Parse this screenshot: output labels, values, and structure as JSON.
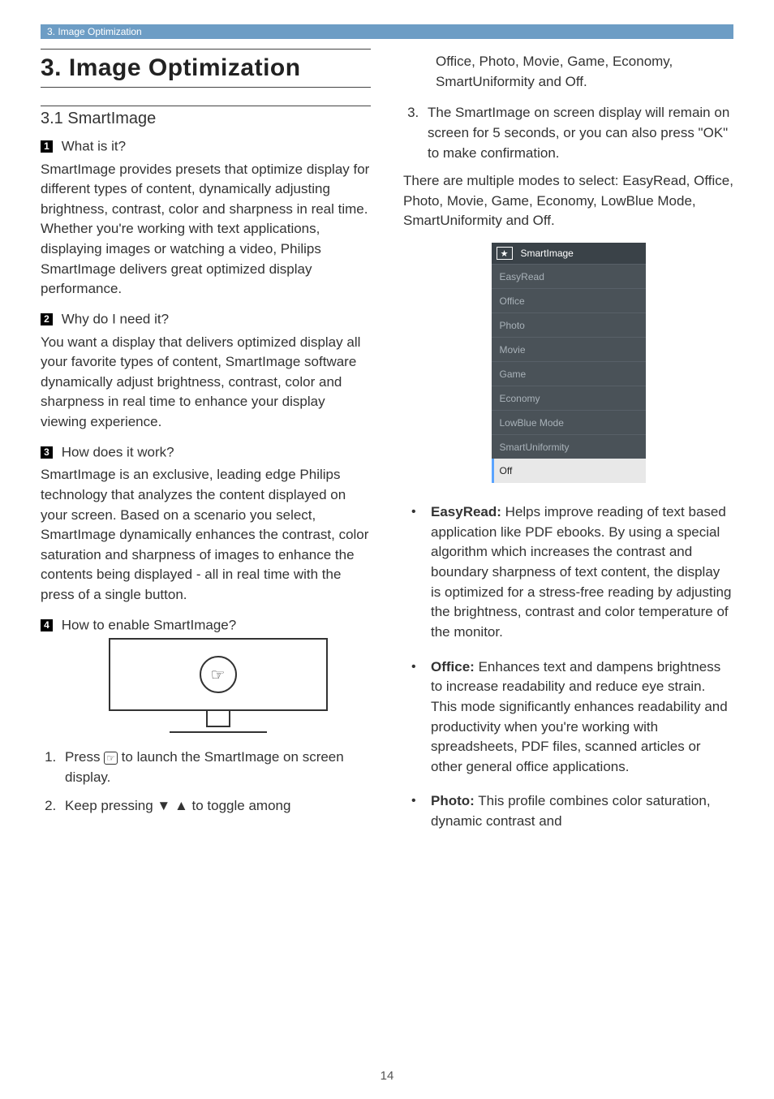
{
  "header": "3. Image Optimization",
  "chapter": "3.  Image Optimization",
  "section": "3.1  SmartImage",
  "q1": {
    "num": "1",
    "title": "What is it?",
    "text": "SmartImage provides presets that optimize display for different types of content, dynamically adjusting brightness, contrast, color and sharpness in real time. Whether you're working with text applications, displaying images or watching a video, Philips SmartImage delivers great optimized display performance."
  },
  "q2": {
    "num": "2",
    "title": "Why do I need it?",
    "text": "You want a display that delivers optimized display all your favorite types of content, SmartImage software dynamically adjust brightness, contrast, color and sharpness in real time to enhance your display viewing experience."
  },
  "q3": {
    "num": "3",
    "title": "How does it work?",
    "text": "SmartImage is an exclusive, leading edge Philips technology that analyzes the content displayed on your screen. Based on a scenario you select, SmartImage dynamically enhances the contrast, color saturation and sharpness of images to enhance the contents being displayed - all in real time with the press of a single button."
  },
  "q4": {
    "num": "4",
    "title": "How to enable SmartImage?"
  },
  "steps": {
    "s1a": "Press ",
    "s1b": " to launch the SmartImage on screen display.",
    "s2a": "Keep pressing ",
    "s2b": " to toggle among",
    "s2c": "Office, Photo, Movie, Game, Economy, SmartUniformity and Off.",
    "s3": "The SmartImage on screen display will remain on screen for 5 seconds, or you can also press \"OK\" to make confirmation."
  },
  "arrows": "▼ ▲",
  "modesIntro": "There are multiple modes to select: EasyRead, Office, Photo, Movie, Game, Economy, LowBlue Mode, SmartUniformity and Off.",
  "osd": {
    "title": "SmartImage",
    "items": [
      "EasyRead",
      "Office",
      "Photo",
      "Movie",
      "Game",
      "Economy",
      "LowBlue Mode",
      "SmartUniformity"
    ],
    "selected": "Off"
  },
  "modeDesc": {
    "easyread": {
      "name": "EasyRead:",
      "text": " Helps improve reading of text based application like PDF ebooks. By using a special algorithm which increases the contrast and boundary sharpness of text content, the display is optimized for a stress-free reading by adjusting the brightness, contrast and color temperature of the monitor."
    },
    "office": {
      "name": "Office:",
      "text": " Enhances text and dampens brightness to increase readability and reduce eye strain. This mode significantly enhances readability and productivity when you're working with spreadsheets, PDF files, scanned articles or other general office applications."
    },
    "photo": {
      "name": "Photo:",
      "text": " This profile combines color saturation, dynamic contrast and"
    }
  },
  "pageNum": "14",
  "iconGlyph": "☞"
}
